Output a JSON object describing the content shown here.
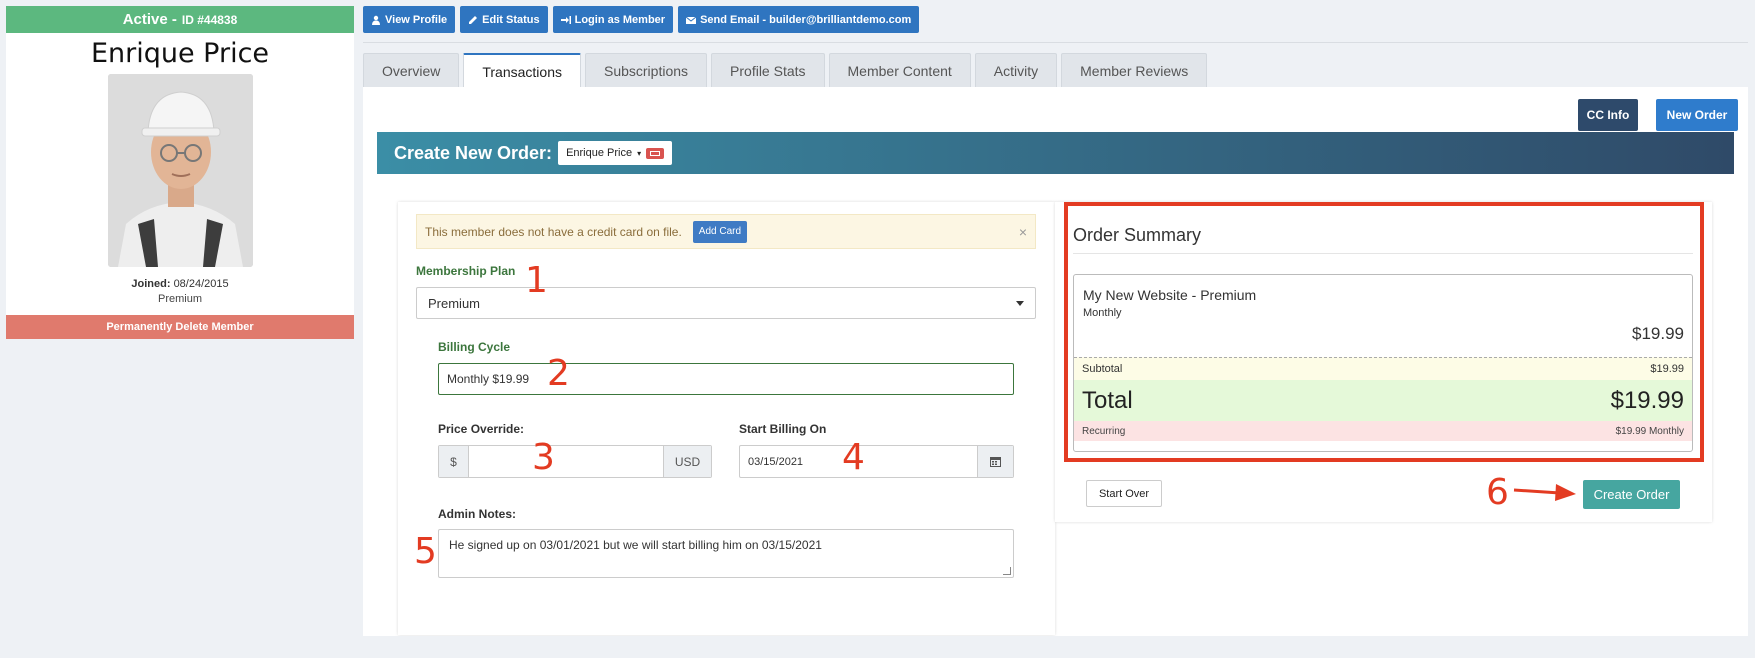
{
  "member": {
    "status": "Active -",
    "id_label": "ID #44838",
    "name": "Enrique Price",
    "joined_label": "Joined:",
    "joined_date": "08/24/2015",
    "level": "Premium",
    "delete_label": "Permanently Delete Member"
  },
  "actions": [
    {
      "label": "View Profile",
      "icon": "user-icon"
    },
    {
      "label": "Edit Status",
      "icon": "edit-icon"
    },
    {
      "label": "Login as Member",
      "icon": "login-icon"
    },
    {
      "label": "Send Email - builder@brilliantdemo.com",
      "icon": "envelope-icon"
    }
  ],
  "tabs": [
    "Overview",
    "Transactions",
    "Subscriptions",
    "Profile Stats",
    "Member Content",
    "Activity",
    "Member Reviews"
  ],
  "active_tab": "Transactions",
  "toolbar": {
    "cc_info": "CC Info",
    "new_order": "New Order"
  },
  "order": {
    "title": "Create New Order:",
    "member_pick": "Enrique Price",
    "alert_text": "This member does not have a credit card on file.",
    "add_card": "Add Card",
    "alert_close": "×",
    "membership_plan_label": "Membership Plan",
    "membership_plan_value": "Premium",
    "billing_cycle_label": "Billing Cycle",
    "billing_cycle_value": "Monthly $19.99",
    "price_override_label": "Price Override:",
    "price_prefix": "$",
    "price_suffix": "USD",
    "price_value": "",
    "start_billing_label": "Start Billing On",
    "start_billing_value": "03/15/2021",
    "admin_notes_label": "Admin Notes:",
    "admin_notes_value": "He signed up on 03/01/2021 but we will start billing him on 03/15/2021"
  },
  "summary": {
    "title": "Order Summary",
    "plan_name": "My New Website - Premium",
    "plan_period": "Monthly",
    "plan_price": "$19.99",
    "subtotal_label": "Subtotal",
    "subtotal_value": "$19.99",
    "total_label": "Total",
    "total_value": "$19.99",
    "recurring_label": "Recurring",
    "recurring_value": "$19.99 Monthly"
  },
  "buttons": {
    "start_over": "Start Over",
    "create_order": "Create Order"
  },
  "annotations": [
    "1",
    "2",
    "3",
    "4",
    "5",
    "6"
  ],
  "colors": {
    "status_green": "#5cb87f",
    "primary_blue": "#2f75c0",
    "danger": "#e07a6d",
    "annotation_red": "#e33b22",
    "create_teal": "#46a6a0"
  }
}
